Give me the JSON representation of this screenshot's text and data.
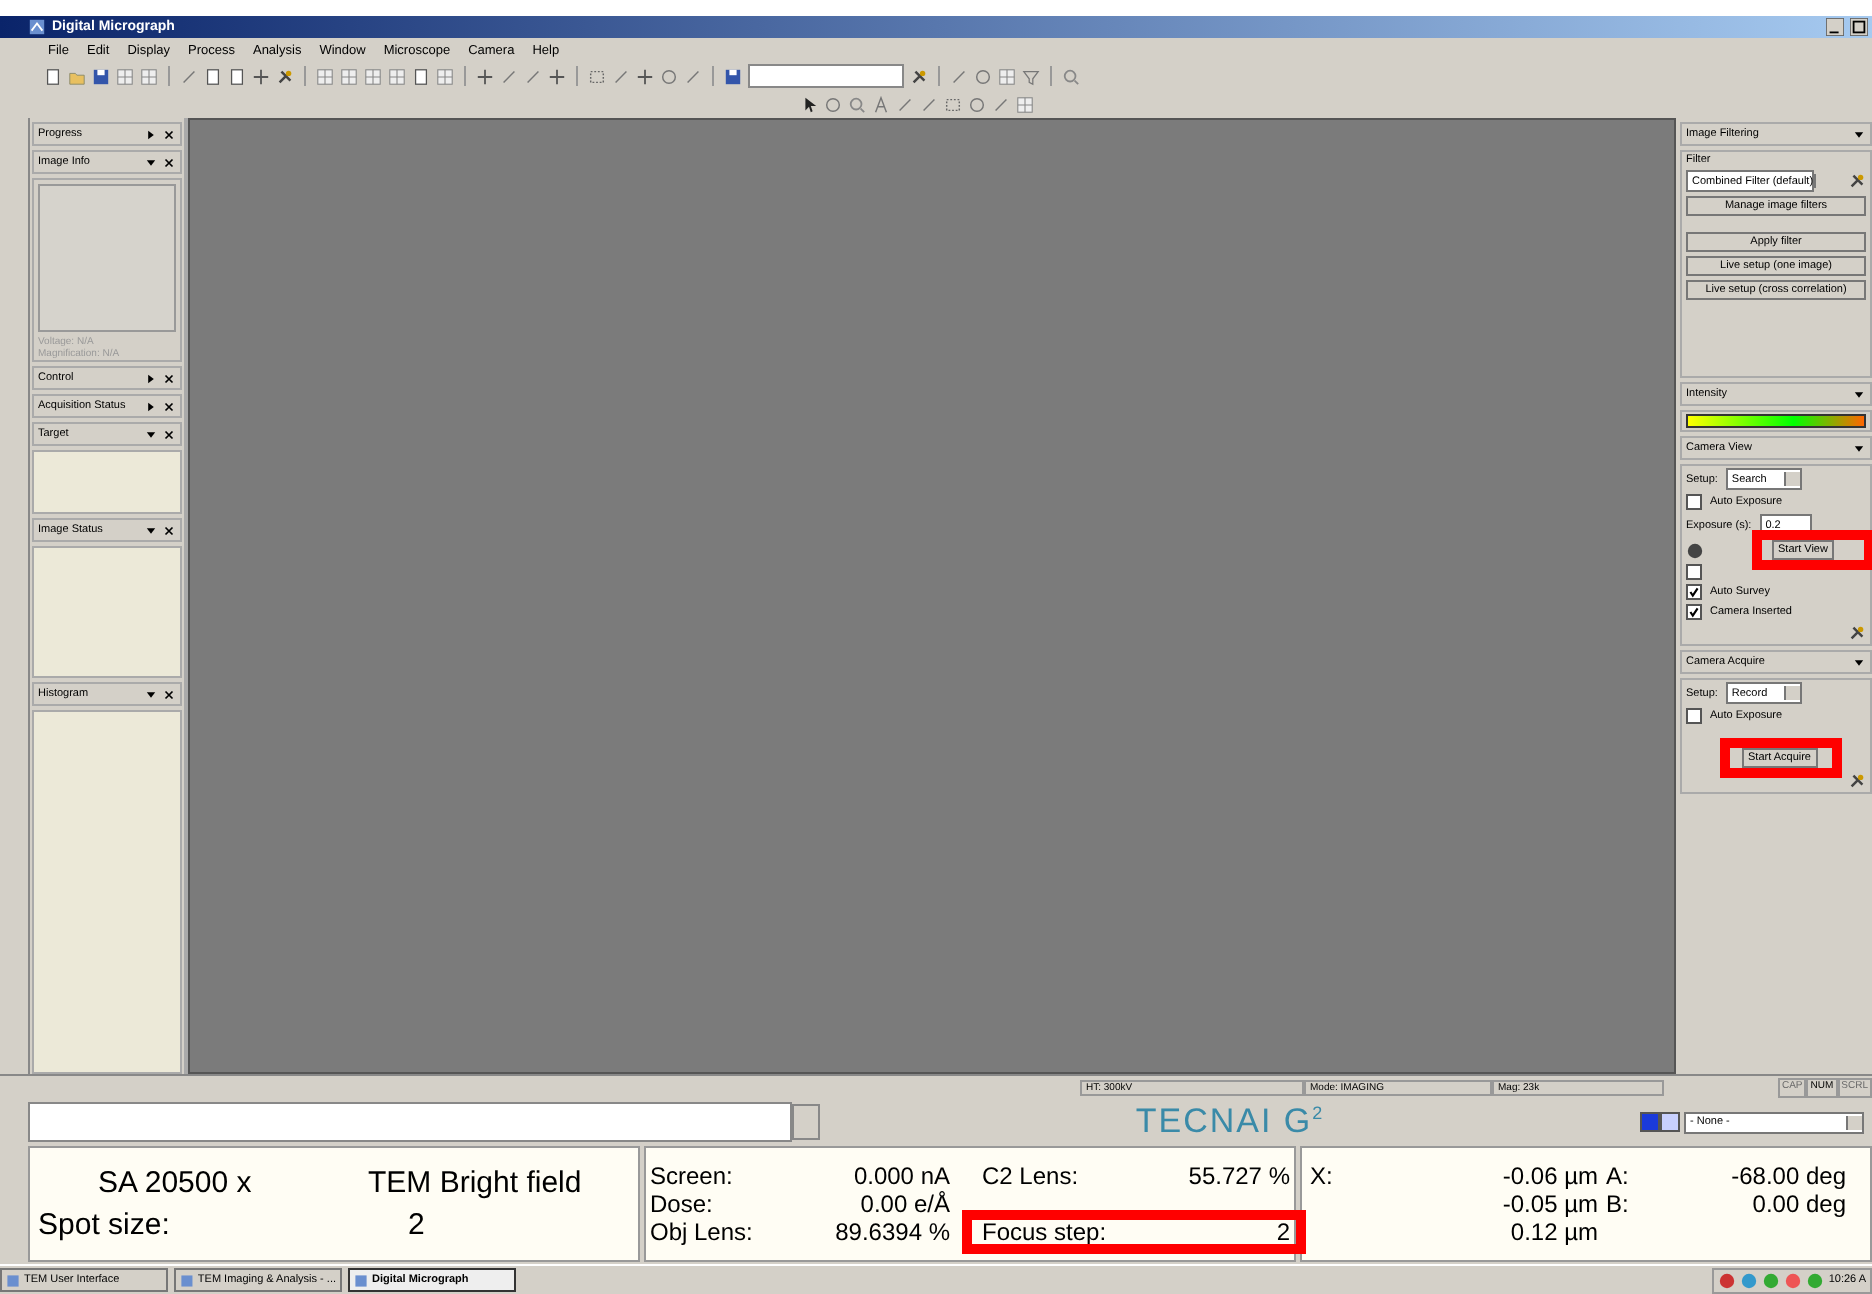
{
  "window": {
    "title": "Digital Micrograph"
  },
  "menu": [
    "File",
    "Edit",
    "Display",
    "Process",
    "Analysis",
    "Window",
    "Microscope",
    "Camera",
    "Help"
  ],
  "left_panels": [
    {
      "title": "Progress",
      "expanded": false
    },
    {
      "title": "Image Info",
      "expanded": true,
      "lines": [
        "Voltage: N/A",
        "Magnification: N/A"
      ]
    },
    {
      "title": "Control",
      "expanded": false
    },
    {
      "title": "Acquisition Status",
      "expanded": false
    },
    {
      "title": "Target",
      "expanded": true
    },
    {
      "title": "Image Status",
      "expanded": true
    },
    {
      "title": "Histogram",
      "expanded": true
    }
  ],
  "image_filtering": {
    "title": "Image Filtering",
    "filter_label": "Filter",
    "filter_value": "Combined Filter (default)",
    "buttons": [
      "Manage image filters",
      "Apply filter",
      "Live setup (one image)",
      "Live setup (cross correlation)"
    ]
  },
  "intensity": {
    "title": "Intensity"
  },
  "camera_view": {
    "title": "Camera View",
    "setup_label": "Setup:",
    "setup_value": "Search",
    "auto_exposure": {
      "label": "Auto Exposure",
      "checked": false
    },
    "exposure_label": "Exposure (s):",
    "exposure_value": "0.2",
    "button": "Start View",
    "options": [
      {
        "checked": false
      },
      {
        "label": "Auto Survey",
        "checked": true
      },
      {
        "label": "Camera Inserted",
        "checked": true
      }
    ]
  },
  "camera_acquire": {
    "title": "Camera Acquire",
    "setup_label": "Setup:",
    "setup_value": "Record",
    "auto_exposure": {
      "label": "Auto Exposure",
      "checked": false
    },
    "button": "Start Acquire"
  },
  "status_bar": {
    "fields": [
      "HT: 300kV",
      "Mode: IMAGING",
      "Mag: 23k"
    ],
    "keys": [
      {
        "label": "CAP",
        "on": false
      },
      {
        "label": "NUM",
        "on": true
      },
      {
        "label": "SCRL",
        "on": false
      }
    ]
  },
  "tecnai": {
    "logo": "TECNAI G$^{2}$",
    "dropdown": "- None -"
  },
  "readouts": {
    "magnification": "SA 20500 x",
    "mode": "TEM Bright field",
    "spot_label": "Spot size:",
    "spot_value": "2",
    "beam": [
      {
        "label": "Screen:",
        "value": "0.000 nA"
      },
      {
        "label": "Dose:",
        "value": "0.00 e/Å"
      },
      {
        "label": "Obj Lens:",
        "value": "89.6394 %"
      }
    ],
    "lens": [
      {
        "label": "C2 Lens:",
        "value": "55.727 %"
      },
      {
        "label": "Focus step:",
        "value": "2"
      }
    ],
    "stage": [
      {
        "label": "X:",
        "value": "-0.06 µm"
      },
      {
        "value": "-0.05 µm"
      },
      {
        "value": "0.12 µm"
      }
    ],
    "tilt": [
      {
        "label": "A:",
        "value": "-68.00 deg"
      },
      {
        "label": "B:",
        "value": "0.00 deg"
      }
    ]
  },
  "taskbar": {
    "items": [
      {
        "label": "TEM User Interface",
        "selected": false
      },
      {
        "label": "TEM Imaging & Analysis - ...",
        "selected": false
      },
      {
        "label": "Digital Micrograph",
        "selected": true
      }
    ],
    "clock": "10:26 A"
  }
}
